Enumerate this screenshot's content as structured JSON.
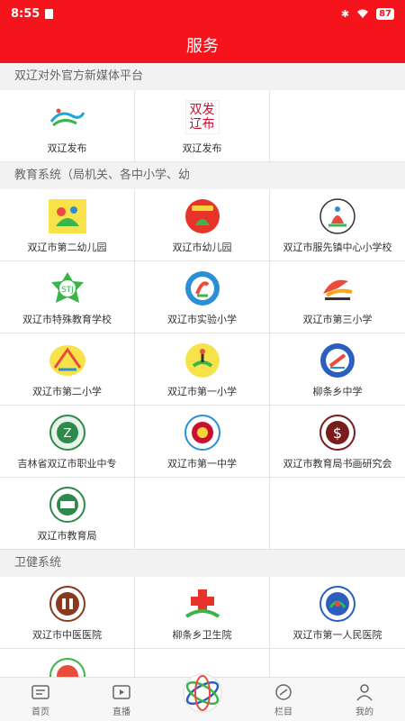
{
  "status": {
    "time": "8:55",
    "battery": "87"
  },
  "header": {
    "title": "服务"
  },
  "sections": [
    {
      "title": "双辽对外官方新媒体平台",
      "items": [
        "双辽发布",
        "双辽发布"
      ]
    },
    {
      "title": "教育系统（局机关、各中小学、幼",
      "items": [
        "双辽市第二幼儿园",
        "双辽市幼儿园",
        "双辽市服先镇中心小学校",
        "双辽市特殊教育学校",
        "双辽市实验小学",
        "双辽市第三小学",
        "双辽市第二小学",
        "双辽市第一小学",
        "柳条乡中学",
        "吉林省双辽市职业中专",
        "双辽市第一中学",
        "双辽市教育局书画研究会",
        "双辽市教育局"
      ]
    },
    {
      "title": "卫健系统",
      "items": [
        "双辽市中医医院",
        "柳条乡卫生院",
        "双辽市第一人民医院"
      ]
    }
  ],
  "logo_text": {
    "fabu": "双发辽布"
  },
  "tabs": [
    {
      "label": "首页",
      "icon": "home-icon"
    },
    {
      "label": "直播",
      "icon": "live-icon"
    },
    {
      "label": "",
      "icon": "globe-icon"
    },
    {
      "label": "栏目",
      "icon": "column-icon"
    },
    {
      "label": "我的",
      "icon": "user-icon"
    }
  ],
  "colors": {
    "brand": "#f5141c"
  }
}
